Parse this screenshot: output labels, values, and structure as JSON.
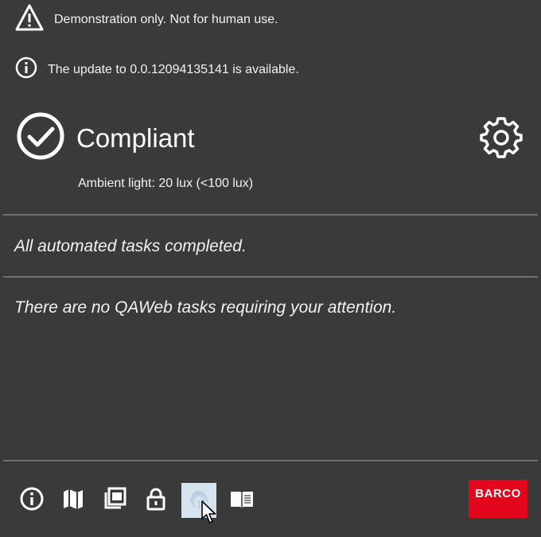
{
  "notices": {
    "warning_text": "Demonstration only. Not for human use.",
    "update_text": "The update to 0.0.12094135141 is available."
  },
  "status": {
    "title": "Compliant",
    "ambient_light": "Ambient light: 20 lux (<100 lux)"
  },
  "messages": {
    "automated": "All automated tasks completed.",
    "tasks": "There are no QAWeb tasks requiring your attention."
  },
  "toolbar": {
    "items": [
      {
        "icon": "info-icon"
      },
      {
        "icon": "map-icon"
      },
      {
        "icon": "gallery-icon"
      },
      {
        "icon": "lock-icon"
      },
      {
        "icon": "fingerprint-icon",
        "active": true
      },
      {
        "icon": "book-icon"
      }
    ]
  },
  "brand": {
    "logo_text": "BARCO",
    "logo_color": "#e3051b"
  },
  "colors": {
    "background": "#3a3a3a",
    "divider": "#6e6e6e",
    "active_tool": "#d6e4f0"
  }
}
